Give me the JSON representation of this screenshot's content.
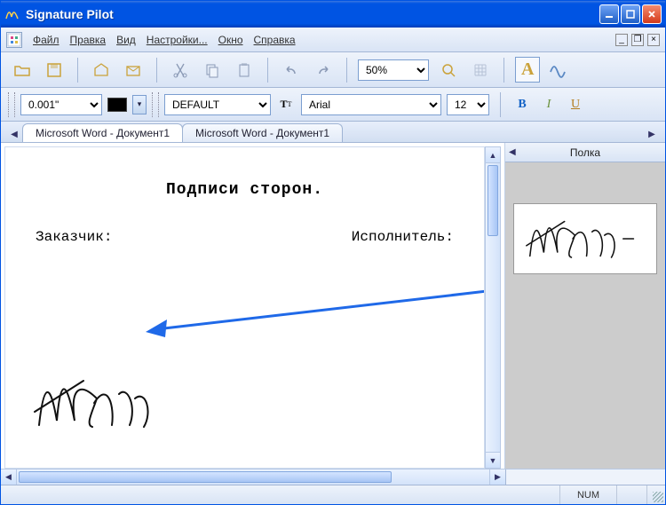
{
  "window": {
    "title": "Signature Pilot"
  },
  "menu": {
    "file": "Файл",
    "edit": "Правка",
    "view": "Вид",
    "settings": "Настройки...",
    "window": "Окно",
    "help": "Справка"
  },
  "toolbar": {
    "zoom_value": "50%",
    "pen_letter": "A"
  },
  "format_bar": {
    "unit_value": "0.001\"",
    "style_value": "DEFAULT",
    "font_value": "Arial",
    "size_value": "12",
    "bold_label": "B",
    "italic_label": "I",
    "underline_label": "U"
  },
  "tabs": {
    "items": [
      {
        "label": "Microsoft Word - Документ1",
        "active": true
      },
      {
        "label": "Microsoft Word - Документ1",
        "active": false
      }
    ]
  },
  "document": {
    "heading": "Подписи сторон.",
    "customer_label": "Заказчик:",
    "contractor_label": "Исполнитель:"
  },
  "shelf": {
    "title": "Полка"
  },
  "statusbar": {
    "num_label": "NUM"
  },
  "colors": {
    "titlebar": "#0054e3",
    "arrow": "#1f69e8"
  }
}
